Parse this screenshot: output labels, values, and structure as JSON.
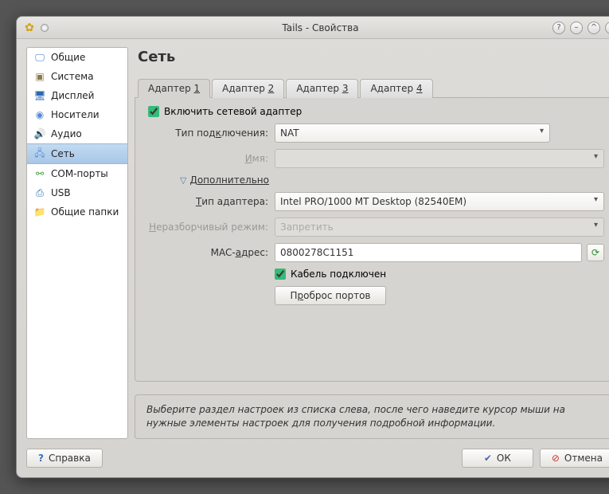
{
  "window": {
    "title": "Tails - Свойства"
  },
  "sidebar": {
    "items": [
      {
        "label": "Общие",
        "icon": "monitor",
        "color": "#3a7cc2"
      },
      {
        "label": "Система",
        "icon": "chip",
        "color": "#8a7a4a"
      },
      {
        "label": "Дисплей",
        "icon": "display",
        "color": "#2a6ab0"
      },
      {
        "label": "Носители",
        "icon": "disc",
        "color": "#5a8ad2"
      },
      {
        "label": "Аудио",
        "icon": "speaker",
        "color": "#7a6a4a"
      },
      {
        "label": "Сеть",
        "icon": "network",
        "color": "#5a9ad2"
      },
      {
        "label": "COM-порты",
        "icon": "serial",
        "color": "#3a9a3a"
      },
      {
        "label": "USB",
        "icon": "usb",
        "color": "#2a6ab0"
      },
      {
        "label": "Общие папки",
        "icon": "folder",
        "color": "#d09030"
      }
    ],
    "selected_index": 5
  },
  "page": {
    "title": "Сеть"
  },
  "tabs": [
    {
      "prefix": "Адаптер ",
      "key": "1"
    },
    {
      "prefix": "Адаптер ",
      "key": "2"
    },
    {
      "prefix": "Адаптер ",
      "key": "3"
    },
    {
      "prefix": "Адаптер ",
      "key": "4"
    }
  ],
  "active_tab": 0,
  "form": {
    "enable_label": "Включить сетевой адаптер",
    "enable": true,
    "conn_type_prefix": "Тип под",
    "conn_type_key": "к",
    "conn_type_suffix": "лючения:",
    "conn_type_value": "NAT",
    "name_prefix": "",
    "name_key": "И",
    "name_suffix": "мя:",
    "name_value": "",
    "advanced_prefix": "",
    "advanced_key": "Д",
    "advanced_suffix": "ополнительно",
    "adapter_type_prefix": "",
    "adapter_type_key": "Т",
    "adapter_type_suffix": "ип адаптера:",
    "adapter_type_value": "Intel PRO/1000 MT Desktop (82540EM)",
    "promisc_prefix": "",
    "promisc_key": "Н",
    "promisc_suffix": "еразборчивый режим:",
    "promisc_value": "Запретить",
    "mac_prefix": "MAC-",
    "mac_key": "а",
    "mac_suffix": "дрес:",
    "mac_value": "0800278C1151",
    "cable_prefix": "",
    "cable_key": "К",
    "cable_suffix": "абель подключен",
    "cable": true,
    "port_fwd_prefix": "П",
    "port_fwd_key": "р",
    "port_fwd_suffix": "оброс портов"
  },
  "hint": "Выберите раздел настроек из списка слева, после чего наведите курсор мыши на нужные элементы настроек для получения подробной информации.",
  "buttons": {
    "help": "Справка",
    "ok": "ОК",
    "cancel": "Отмена"
  }
}
